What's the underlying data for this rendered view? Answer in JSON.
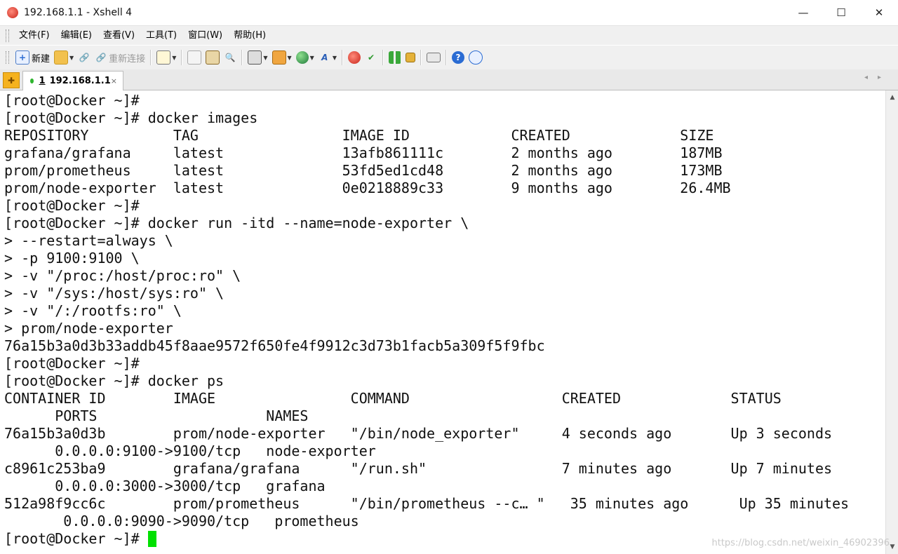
{
  "window": {
    "title": "192.168.1.1 - Xshell 4",
    "controls": {
      "minimize": "—",
      "maximize": "☐",
      "close": "✕"
    }
  },
  "menu": [
    "文件(F)",
    "编辑(E)",
    "查看(V)",
    "工具(T)",
    "窗口(W)",
    "帮助(H)"
  ],
  "toolbar": {
    "new_label": "新建",
    "reconnect_label": "重新连接"
  },
  "tabs": [
    {
      "number": "1",
      "label": "192.168.1.1",
      "close": "×"
    }
  ],
  "terminal": {
    "lines": [
      "[root@Docker ~]#",
      "[root@Docker ~]# docker images",
      "REPOSITORY          TAG                 IMAGE ID            CREATED             SIZE",
      "grafana/grafana     latest              13afb861111c        2 months ago        187MB",
      "prom/prometheus     latest              53fd5ed1cd48        2 months ago        173MB",
      "prom/node-exporter  latest              0e0218889c33        9 months ago        26.4MB",
      "[root@Docker ~]#",
      "[root@Docker ~]# docker run -itd --name=node-exporter \\",
      "> --restart=always \\",
      "> -p 9100:9100 \\",
      "> -v \"/proc:/host/proc:ro\" \\",
      "> -v \"/sys:/host/sys:ro\" \\",
      "> -v \"/:/rootfs:ro\" \\",
      "> prom/node-exporter",
      "76a15b3a0d3b33addb45f8aae9572f650fe4f9912c3d73b1facb5a309f5f9fbc",
      "[root@Docker ~]#",
      "[root@Docker ~]# docker ps",
      "CONTAINER ID        IMAGE                COMMAND                  CREATED             STATUS",
      "      PORTS                    NAMES",
      "76a15b3a0d3b        prom/node-exporter   \"/bin/node_exporter\"     4 seconds ago       Up 3 seconds",
      "      0.0.0.0:9100->9100/tcp   node-exporter",
      "c8961c253ba9        grafana/grafana      \"/run.sh\"                7 minutes ago       Up 7 minutes",
      "      0.0.0.0:3000->3000/tcp   grafana",
      "512a98f9cc6c        prom/prometheus      \"/bin/prometheus --c… \"   35 minutes ago      Up 35 minutes",
      "       0.0.0.0:9090->9090/tcp   prometheus"
    ],
    "prompt": "[root@Docker ~]# "
  },
  "watermark": "https://blog.csdn.net/weixin_46902396"
}
